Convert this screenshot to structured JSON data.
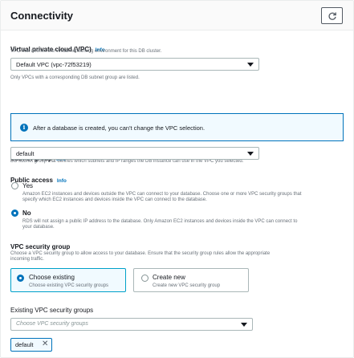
{
  "header": {
    "title": "Connectivity"
  },
  "vpc": {
    "label": "Virtual private cloud (VPC)",
    "info": "Info",
    "description": "VPC that defines the virtual networking environment for this DB cluster.",
    "selected": "Default VPC (vpc-72f53219)",
    "hint": "Only VPCs with a corresponding DB subnet group are listed."
  },
  "alert": {
    "text": "After a database is created, you can't change the VPC selection."
  },
  "subnet_group": {
    "label": "Subnet group",
    "info": "Info",
    "description": "DB subnet group that defines which subnets and IP ranges the DB instance can use in the VPC you selected.",
    "selected": "default"
  },
  "public_access": {
    "label": "Public access",
    "info": "Info",
    "options": [
      {
        "label": "Yes",
        "description_line1": "Amazon EC2 instances and devices outside the VPC can connect to your database. Choose one or more VPC security groups that",
        "description_line2": "specify which EC2 instances and devices inside the VPC can connect to the database.",
        "checked": false
      },
      {
        "label": "No",
        "description_line1": "RDS will not assign a public IP address to the database. Only Amazon EC2 instances and devices inside the VPC can connect to",
        "description_line2": "your database.",
        "checked": true
      }
    ]
  },
  "vpc_security_group": {
    "label": "VPC security group",
    "description_line1": "Choose a VPC security group to allow access to your database. Ensure that the security group rules allow the appropriate",
    "description_line2": "incoming traffic.",
    "options": [
      {
        "title": "Choose existing",
        "subtitle": "Choose existing VPC security groups",
        "selected": true
      },
      {
        "title": "Create new",
        "subtitle": "Create new VPC security group",
        "selected": false
      }
    ]
  },
  "existing_groups": {
    "label": "Existing VPC security groups",
    "placeholder": "Choose VPC security groups",
    "tokens": [
      {
        "label": "default",
        "remove": "✕"
      }
    ]
  },
  "icons": {
    "refresh": "refresh-icon",
    "info": "info-circle-icon",
    "caret": "caret-down-icon",
    "remove": "close-icon"
  },
  "colors": {
    "accent": "#0073bb",
    "tile_selected_border": "#00a1c9",
    "alert_background": "#f1faff"
  }
}
